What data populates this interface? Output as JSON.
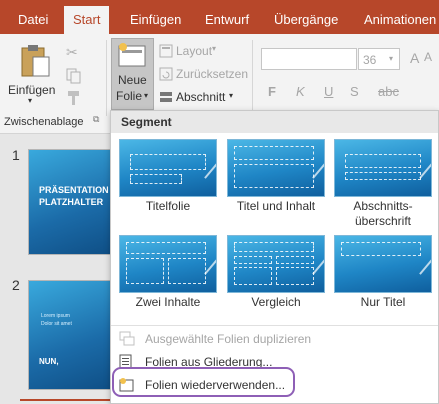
{
  "tabs": [
    "Datei",
    "Start",
    "Einfügen",
    "Entwurf",
    "Übergänge",
    "Animationen"
  ],
  "active_tab": "Start",
  "ribbon": {
    "paste_label": "Einfügen",
    "clipboard_group": "Zwischenablage",
    "new_slide_line1": "Neue",
    "new_slide_line2": "Folie",
    "layout": "Layout",
    "reset": "Zurücksetzen",
    "section": "Abschnitt",
    "font_size": "36"
  },
  "slides": [
    {
      "number": "1",
      "title": "PRÄSENTATION PLATZHALTER"
    },
    {
      "number": "2",
      "bullets": [
        "Lorem ipsum",
        "Dolor sit amet"
      ],
      "footer": "NUN,"
    }
  ],
  "menu": {
    "heading": "Segment",
    "layouts": [
      "Titelfolie",
      "Titel und Inhalt",
      "Abschnitts-\nüberschrift",
      "Zwei Inhalte",
      "Vergleich",
      "Nur Titel"
    ],
    "items": [
      "Ausgewählte Folien duplizieren",
      "Folien aus Gliederung...",
      "Folien wiederverwenden..."
    ]
  },
  "colors": {
    "accent": "#b7472a",
    "highlight": "#8e5fb6"
  }
}
